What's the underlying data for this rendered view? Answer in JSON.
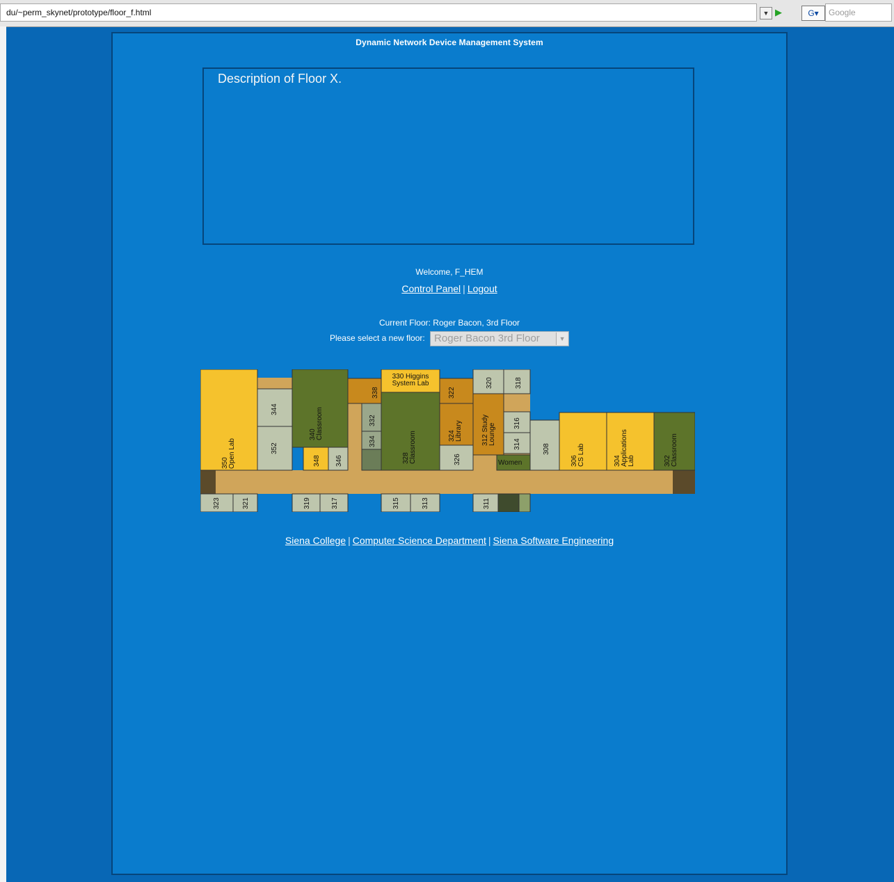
{
  "browser": {
    "url": "du/~perm_skynet/prototype/floor_f.html",
    "search_placeholder": "Google"
  },
  "page": {
    "system_title": "Dynamic Network Device Management System",
    "description": "Description of Floor X.",
    "welcome": "Welcome, F_HEM",
    "links": {
      "control_panel": "Control Panel",
      "logout": "Logout"
    },
    "current_floor": "Current Floor: Roger Bacon, 3rd Floor",
    "select_prompt": "Please select a new floor:",
    "selected_floor": "Roger Bacon 3rd Floor",
    "footer": {
      "siena_college": "Siena College",
      "cs_department": "Computer Science Department",
      "siena_se": "Siena Software Engineering"
    }
  },
  "floorplan": {
    "colors": {
      "hall": "#d0a55a",
      "dark_green": "#5d742a",
      "sage": "#bec6ad",
      "yellow": "#f5c22d",
      "orange": "#c8891d",
      "dark_wall": "#5b4a2a"
    },
    "rooms": [
      {
        "id": "350",
        "lines": [
          "350",
          "Open Lab"
        ]
      },
      {
        "id": "344",
        "lines": [
          "344"
        ]
      },
      {
        "id": "352",
        "lines": [
          "352"
        ]
      },
      {
        "id": "340",
        "lines": [
          "340",
          "Classroom"
        ]
      },
      {
        "id": "348",
        "lines": [
          "348"
        ]
      },
      {
        "id": "346",
        "lines": [
          "346"
        ]
      },
      {
        "id": "338",
        "lines": [
          "338"
        ]
      },
      {
        "id": "332",
        "lines": [
          "332"
        ]
      },
      {
        "id": "334",
        "lines": [
          "334"
        ]
      },
      {
        "id": "330",
        "lines": [
          "330 Higgins",
          "System Lab"
        ]
      },
      {
        "id": "328",
        "lines": [
          "328",
          "Classroom"
        ]
      },
      {
        "id": "322",
        "lines": [
          "322"
        ]
      },
      {
        "id": "324",
        "lines": [
          "324",
          "Library"
        ]
      },
      {
        "id": "326",
        "lines": [
          "326"
        ]
      },
      {
        "id": "320",
        "lines": [
          "320"
        ]
      },
      {
        "id": "318",
        "lines": [
          "318"
        ]
      },
      {
        "id": "312",
        "lines": [
          "312 Study",
          "Lounge"
        ]
      },
      {
        "id": "316",
        "lines": [
          "316"
        ]
      },
      {
        "id": "314",
        "lines": [
          "314"
        ]
      },
      {
        "id": "women",
        "lines": [
          "Women"
        ]
      },
      {
        "id": "308",
        "lines": [
          "308"
        ]
      },
      {
        "id": "306",
        "lines": [
          "306",
          "CS Lab"
        ]
      },
      {
        "id": "304",
        "lines": [
          "304",
          "Applications",
          "Lab"
        ]
      },
      {
        "id": "302",
        "lines": [
          "302",
          "Classroom"
        ]
      },
      {
        "id": "323",
        "lines": [
          "323"
        ]
      },
      {
        "id": "321",
        "lines": [
          "321"
        ]
      },
      {
        "id": "319",
        "lines": [
          "319"
        ]
      },
      {
        "id": "317",
        "lines": [
          "317"
        ]
      },
      {
        "id": "315",
        "lines": [
          "315"
        ]
      },
      {
        "id": "313",
        "lines": [
          "313"
        ]
      },
      {
        "id": "311",
        "lines": [
          "311"
        ]
      }
    ]
  }
}
